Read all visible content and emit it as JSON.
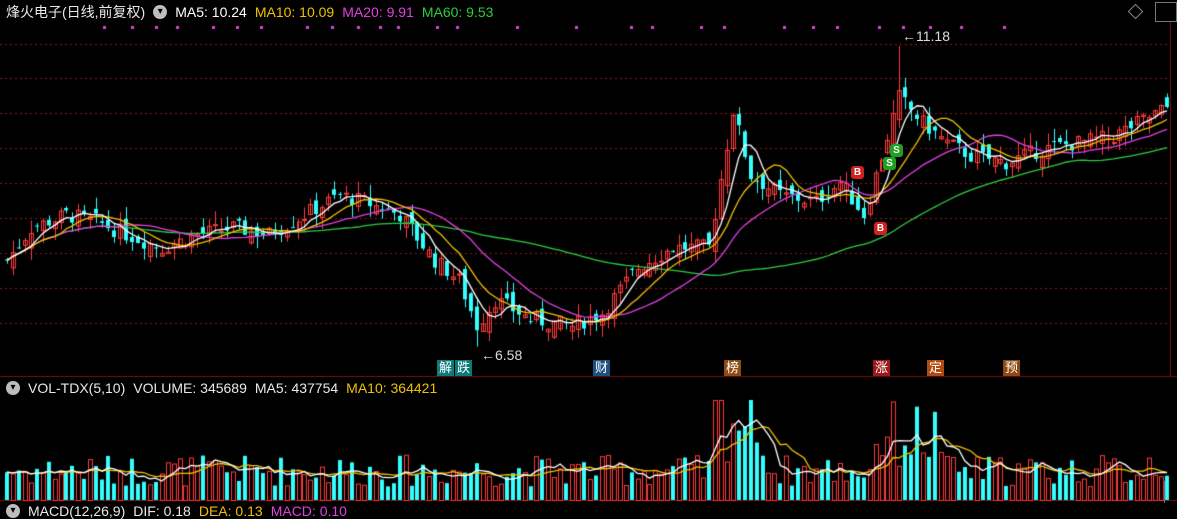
{
  "main_header": {
    "title": "烽火电子(日线,前复权)",
    "ma5_label": "MA5: 10.24",
    "ma10_label": "MA10: 10.09",
    "ma20_label": "MA20: 9.91",
    "ma60_label": "MA60: 9.53",
    "toggle_icon": "chevron-down-icon"
  },
  "colors": {
    "up": "#ff3b3b",
    "down": "#35ffff",
    "ma5": "#ffffff",
    "ma10": "#f0c000",
    "ma20": "#e040e0",
    "ma60": "#2ecc40",
    "grid": "#8a1a1a",
    "signal_buy": "#d02020",
    "signal_sell": "#20a020",
    "event_marker": "#e040e0"
  },
  "annotations": {
    "high_label": "11.18",
    "low_label": "6.58"
  },
  "event_badges": [
    {
      "label": "解",
      "color": "#0d7a7a"
    },
    {
      "label": "跌",
      "color": "#0d7a7a"
    },
    {
      "label": "财",
      "color": "#1d4f80"
    },
    {
      "label": "榜",
      "color": "#8a4a10"
    },
    {
      "label": "涨",
      "color": "#9a1a1a"
    },
    {
      "label": "定",
      "color": "#b04a10"
    },
    {
      "label": "预",
      "color": "#8a4a10"
    }
  ],
  "signals": [
    {
      "label": "B",
      "type": "buy"
    },
    {
      "label": "B",
      "type": "buy"
    },
    {
      "label": "S",
      "type": "sell"
    },
    {
      "label": "S",
      "type": "sell"
    }
  ],
  "volume_header": {
    "title": "VOL-TDX(5,10)",
    "volume_label": "VOLUME: 345689",
    "ma5_label": "MA5: 437754",
    "ma10_label": "MA10: 364421"
  },
  "macd_header": {
    "title": "MACD(12,26,9)",
    "dif_label": "DIF: 0.18",
    "dea_label": "DEA: 0.13",
    "macd_label": "MACD: 0.10"
  }
}
